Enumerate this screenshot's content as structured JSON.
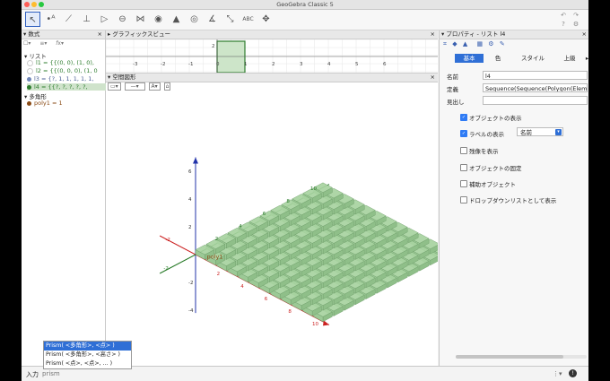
{
  "window": {
    "title": "GeoGebra Classic 5"
  },
  "colors": {
    "accent": "#2f6fd6",
    "shape_fill": "#a7d3a0",
    "shape_stroke": "#6a9a66",
    "z_axis": "#2233aa",
    "x_axis": "#cc2222",
    "y_axis": "#227722"
  },
  "algebra": {
    "header": "数式",
    "group_list": "リスト",
    "items": [
      {
        "text": "l1 = {{(0, 0), (1, 0),",
        "color": "#2e7d2e",
        "selected": false,
        "visible": false
      },
      {
        "text": "l2 = {{(0, 0, 0), (1, 0",
        "color": "#2e7d2e",
        "selected": false,
        "visible": false
      },
      {
        "text": "l3 = {?, 1, 1, 1, 1, 1,",
        "color": "#6f86b8",
        "selected": false,
        "visible": true
      },
      {
        "text": "l4 = {{?, ?, ?, ?, ?,",
        "color": "#2e7d2e",
        "selected": true,
        "visible": true
      }
    ],
    "group_polygon": "多角形",
    "poly_item": "poly1 = 1"
  },
  "graphics2d": {
    "header": "グラフィックスビュー",
    "x_ticks": [
      "-3",
      "-2",
      "-1",
      "0",
      "1",
      "2",
      "3",
      "4",
      "5",
      "6"
    ],
    "y_tick": "2"
  },
  "graphics3d": {
    "header": "空間図形",
    "z_ticks": [
      "6",
      "4",
      "2",
      "-2",
      "-4"
    ],
    "x_ticks": [
      "2",
      "4",
      "6",
      "8",
      "10"
    ],
    "y_ticks": [
      "2",
      "4",
      "6",
      "8",
      "10"
    ],
    "neg_x": "-2",
    "neg_y": "-2",
    "poly_label": "poly1"
  },
  "properties": {
    "header": "プロパティ - リスト l4",
    "tabs": [
      "基本",
      "色",
      "スタイル",
      "上級"
    ],
    "name_label": "名前",
    "name_value": "l4",
    "def_label": "定義",
    "def_value": "Sequence(Sequence(Polygon(Elemen",
    "caption_label": "見出し",
    "caption_value": "",
    "checkboxes": [
      {
        "label": "オブジェクトの表示",
        "checked": true
      },
      {
        "label": "ラベルの表示",
        "checked": true
      },
      {
        "label": "残像を表示",
        "checked": false
      },
      {
        "label": "オブジェクトの固定",
        "checked": false
      },
      {
        "label": "補助オブジェクト",
        "checked": false
      },
      {
        "label": "ドロップダウンリストとして表示",
        "checked": false
      }
    ],
    "label_mode": "名前"
  },
  "input": {
    "label": "入力",
    "value": "prism",
    "suggestions": [
      "Prism( <多角形>, <点> )",
      "Prism( <多角形>, <高さ> )",
      "Prism( <点>, <点>, ... )"
    ]
  }
}
